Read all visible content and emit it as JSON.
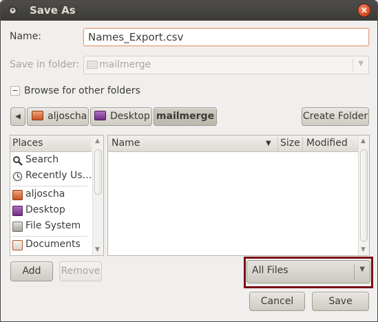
{
  "window": {
    "title": "Save As"
  },
  "name_row": {
    "label": "Name:",
    "value": "Names_Export.csv"
  },
  "folder_row": {
    "label": "Save in folder:",
    "value": "mailmerge"
  },
  "browse": {
    "label": "Browse for other folders",
    "expander_symbol": "−"
  },
  "path_bar": {
    "back_arrow": "◀",
    "buttons": [
      {
        "label": "aljoscha",
        "icon": "home-folder-icon"
      },
      {
        "label": "Desktop",
        "icon": "desktop-folder-icon"
      },
      {
        "label": "mailmerge",
        "icon": null
      }
    ],
    "create_folder": "Create Folder"
  },
  "places": {
    "header": "Places",
    "items": [
      {
        "label": "Search",
        "icon": "search-icon"
      },
      {
        "label": "Recently Us…",
        "icon": "recent-icon"
      },
      {
        "label": "aljoscha",
        "icon": "home-folder-icon"
      },
      {
        "label": "Desktop",
        "icon": "desktop-folder-icon"
      },
      {
        "label": "File System",
        "icon": "drive-icon"
      },
      {
        "label": "Documents",
        "icon": "documents-folder-icon"
      }
    ],
    "add": "Add",
    "remove": "Remove"
  },
  "files": {
    "columns": {
      "name": "Name",
      "size": "Size",
      "modified": "Modified"
    },
    "sort_indicator": "▼"
  },
  "filter": {
    "value": "All Files",
    "arrow": "▼"
  },
  "actions": {
    "cancel": "Cancel",
    "save": "Save"
  },
  "colors": {
    "title_bar": "#3b3a36",
    "highlight": "#7a0e14",
    "close": "#d9481f"
  }
}
